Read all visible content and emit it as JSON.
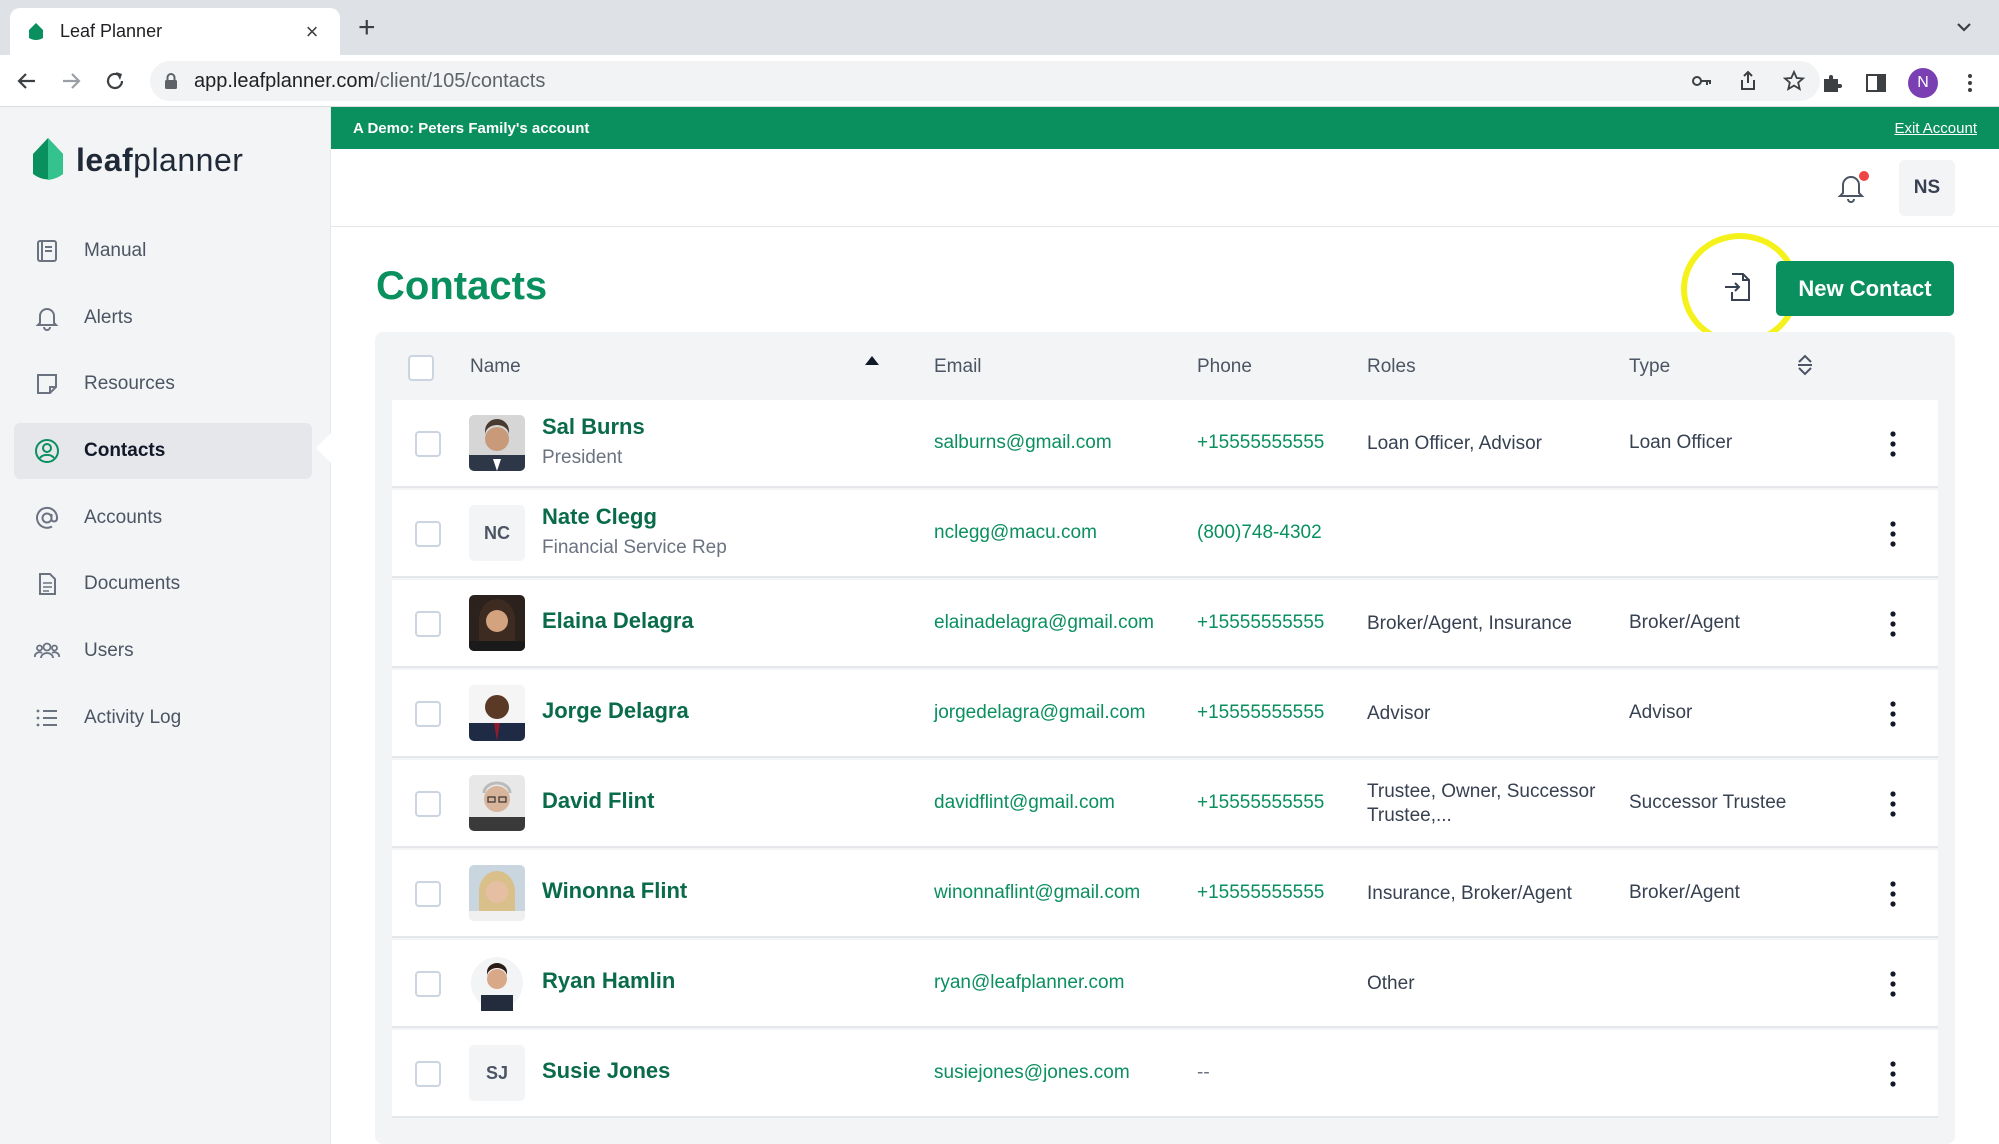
{
  "browser": {
    "tab_title": "Leaf Planner",
    "url_host": "app.leafplanner.com",
    "url_path": "/client/105/contacts",
    "profile_initial": "N"
  },
  "app": {
    "logo_bold": "leaf",
    "logo_light": "planner",
    "brand_color": "#0a8f5f"
  },
  "sidebar": {
    "items": [
      {
        "label": "Manual",
        "icon": "book-icon"
      },
      {
        "label": "Alerts",
        "icon": "bell-icon"
      },
      {
        "label": "Resources",
        "icon": "note-icon"
      },
      {
        "label": "Contacts",
        "icon": "contact-icon",
        "active": true
      },
      {
        "label": "Accounts",
        "icon": "at-icon"
      },
      {
        "label": "Documents",
        "icon": "document-icon"
      },
      {
        "label": "Users",
        "icon": "users-icon"
      },
      {
        "label": "Activity Log",
        "icon": "list-icon"
      }
    ]
  },
  "demo_bar": {
    "text": "A Demo: Peters Family's account",
    "exit_label": "Exit Account"
  },
  "header": {
    "user_initials": "NS"
  },
  "page": {
    "title": "Contacts",
    "new_contact_label": "New Contact"
  },
  "table": {
    "columns": [
      "Name",
      "Email",
      "Phone",
      "Roles",
      "Type"
    ],
    "rows": [
      {
        "name": "Sal Burns",
        "subtitle": "President",
        "email": "salburns@gmail.com",
        "phone": "+15555555555",
        "roles": "Loan Officer, Advisor",
        "type": "Loan Officer",
        "initials": ""
      },
      {
        "name": "Nate Clegg",
        "subtitle": "Financial Service Rep",
        "email": "nclegg@macu.com",
        "phone": "(800)748-4302",
        "roles": "",
        "type": "",
        "initials": "NC"
      },
      {
        "name": "Elaina Delagra",
        "subtitle": "",
        "email": "elainadelagra@gmail.com",
        "phone": "+15555555555",
        "roles": "Broker/Agent, Insurance",
        "type": "Broker/Agent",
        "initials": ""
      },
      {
        "name": "Jorge Delagra",
        "subtitle": "",
        "email": "jorgedelagra@gmail.com",
        "phone": "+15555555555",
        "roles": "Advisor",
        "type": "Advisor",
        "initials": ""
      },
      {
        "name": "David Flint",
        "subtitle": "",
        "email": "davidflint@gmail.com",
        "phone": "+15555555555",
        "roles": "Trustee, Owner, Successor Trustee,...",
        "type": "Successor Trustee",
        "initials": ""
      },
      {
        "name": "Winonna Flint",
        "subtitle": "",
        "email": "winonnaflint@gmail.com",
        "phone": "+15555555555",
        "roles": "Insurance, Broker/Agent",
        "type": "Broker/Agent",
        "initials": ""
      },
      {
        "name": "Ryan Hamlin",
        "subtitle": "",
        "email": "ryan@leafplanner.com",
        "phone": "",
        "roles": "Other",
        "type": "",
        "initials": ""
      },
      {
        "name": "Susie Jones",
        "subtitle": "",
        "email": "susiejones@jones.com",
        "phone": "--",
        "roles": "",
        "type": "",
        "initials": "SJ"
      }
    ]
  }
}
